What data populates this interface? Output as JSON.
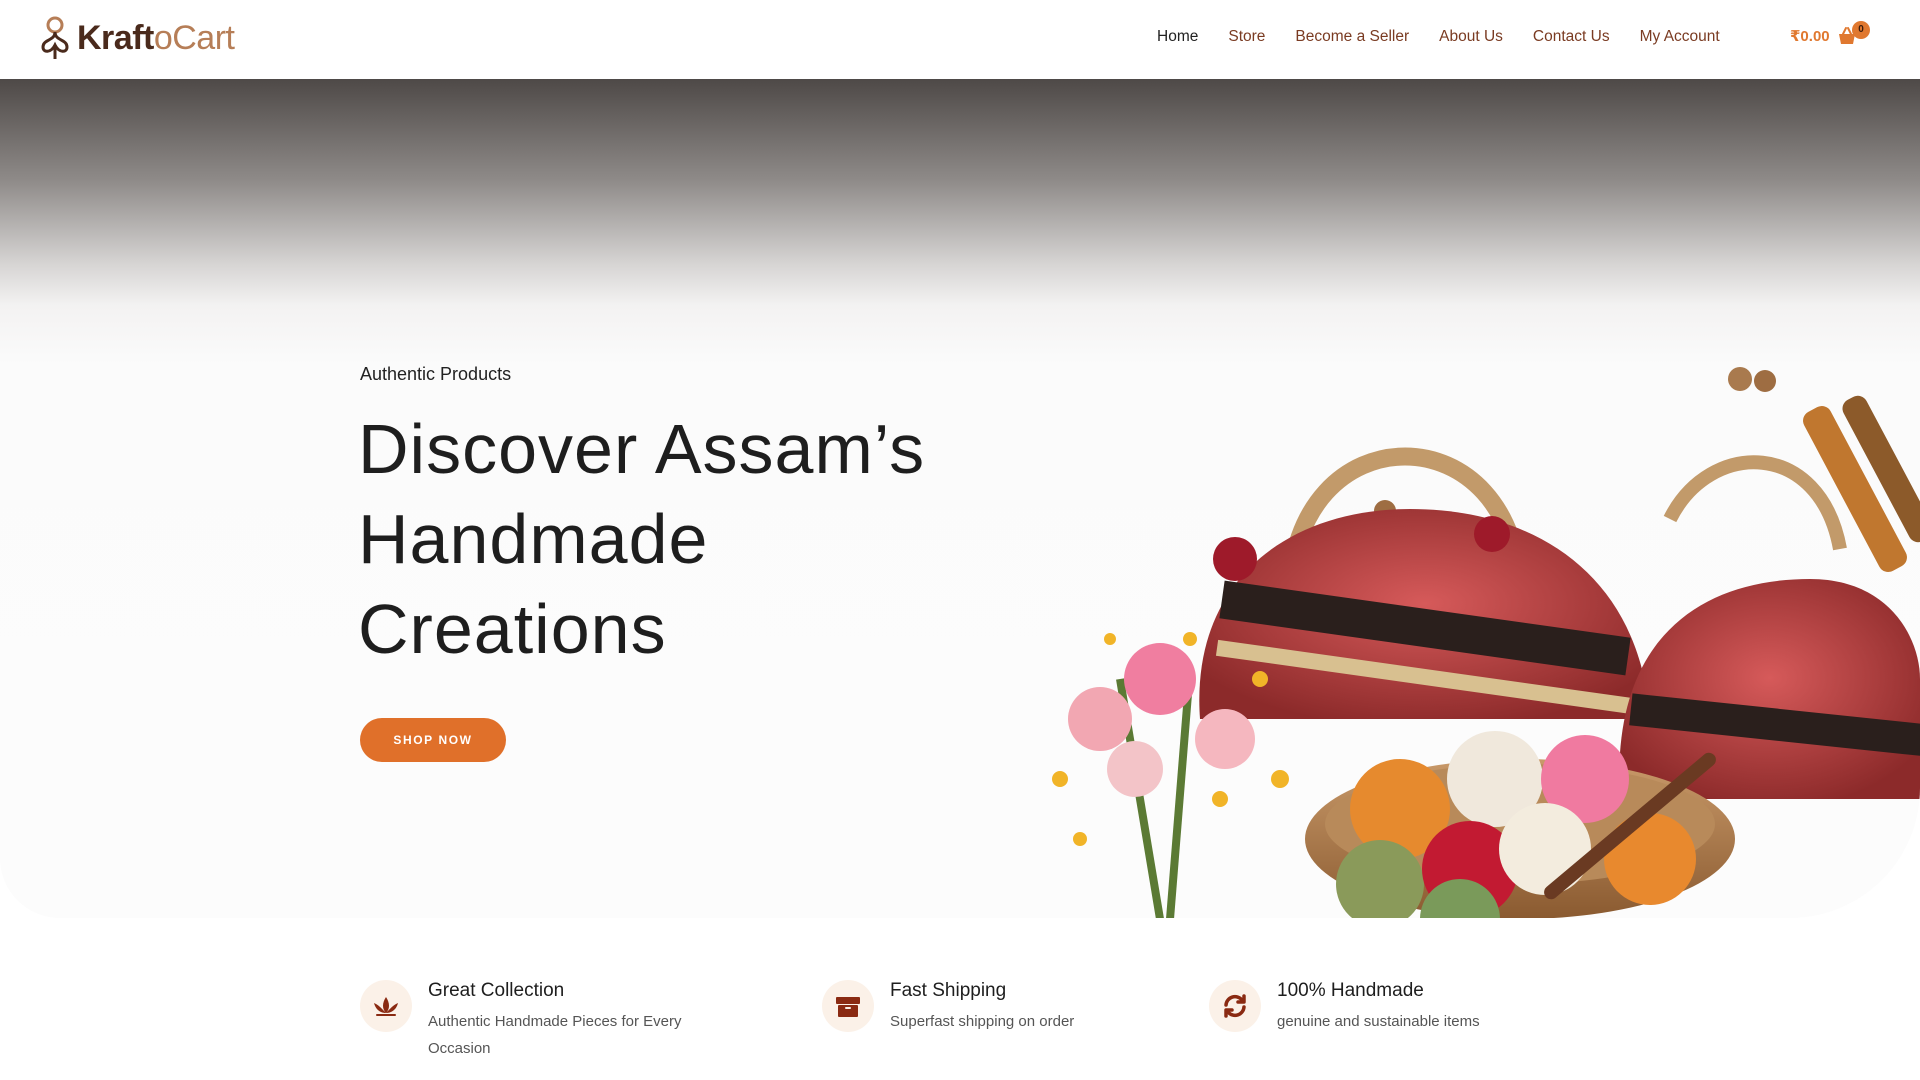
{
  "brand": {
    "name_part1": "Kraft",
    "name_part2": "oCart",
    "logo_icon": "kraftocart-logo-icon"
  },
  "nav": {
    "items": [
      {
        "label": "Home",
        "active": true
      },
      {
        "label": "Store",
        "active": false
      },
      {
        "label": "Become a Seller",
        "active": false
      },
      {
        "label": "About Us",
        "active": false
      },
      {
        "label": "Contact Us",
        "active": false
      },
      {
        "label": "My Account",
        "active": false
      }
    ],
    "cart_amount": "₹0.00",
    "cart_count": "0",
    "cart_icon": "shopping-basket-icon"
  },
  "hero": {
    "eyebrow": "Authentic Products",
    "title_lines": [
      "Discover Assam’s",
      "Handmade",
      "Creations"
    ],
    "cta_label": "SHOP NOW"
  },
  "features": [
    {
      "icon": "lotus-icon",
      "title": "Great Collection",
      "desc_line1": "Authentic Handmade Pieces for Every",
      "desc_line2": "Occasion"
    },
    {
      "icon": "box-icon",
      "title": "Fast Shipping",
      "desc_line1": "Superfast shipping on order",
      "desc_line2": ""
    },
    {
      "icon": "refresh-icon",
      "title": "100% Handmade",
      "desc_line1": "genuine and sustainable items",
      "desc_line2": ""
    }
  ],
  "colors": {
    "accent": "#e0702a",
    "brand_dark": "#4a2a1c",
    "brand_light": "#b67e57",
    "nav_text": "#7a3b22",
    "feature_icon": "#8a2a12"
  }
}
